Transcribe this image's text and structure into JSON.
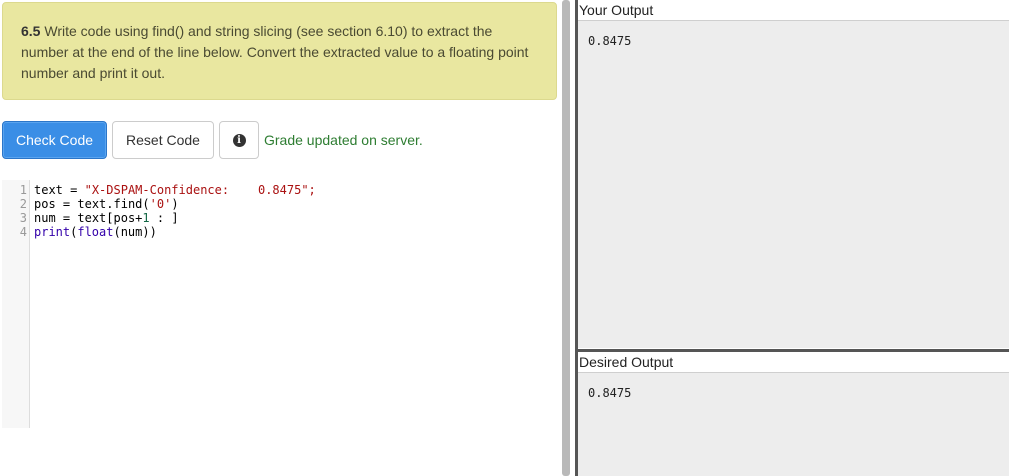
{
  "prompt": {
    "number": "6.5",
    "text": " Write code using find() and string slicing (see section 6.10) to extract the number at the end of the line below. Convert the extracted value to a floating point number and print it out."
  },
  "buttons": {
    "check_label": "Check Code",
    "reset_label": "Reset Code",
    "info_icon": "i"
  },
  "status": {
    "message": "Grade updated on server."
  },
  "editor": {
    "lines": [
      {
        "num": "1",
        "tokens": [
          {
            "t": "text",
            "c": "var"
          },
          {
            "t": " = ",
            "c": "var"
          },
          {
            "t": "\"X-DSPAM-Confidence:    0.8475\";",
            "c": "str"
          }
        ]
      },
      {
        "num": "2",
        "tokens": [
          {
            "t": "pos",
            "c": "var"
          },
          {
            "t": " = ",
            "c": "var"
          },
          {
            "t": "text.find(",
            "c": "var"
          },
          {
            "t": "'0'",
            "c": "str"
          },
          {
            "t": ")",
            "c": "var"
          }
        ]
      },
      {
        "num": "3",
        "tokens": [
          {
            "t": "num",
            "c": "var"
          },
          {
            "t": " = ",
            "c": "var"
          },
          {
            "t": "text[pos+",
            "c": "var"
          },
          {
            "t": "1",
            "c": "num"
          },
          {
            "t": " : ]",
            "c": "var"
          }
        ]
      },
      {
        "num": "4",
        "tokens": [
          {
            "t": "print",
            "c": "builtin"
          },
          {
            "t": "(",
            "c": "var"
          },
          {
            "t": "float",
            "c": "builtin"
          },
          {
            "t": "(num))",
            "c": "var"
          }
        ]
      }
    ]
  },
  "your_output": {
    "title": "Your Output",
    "value": "0.8475"
  },
  "desired_output": {
    "title": "Desired Output",
    "value": "0.8475"
  },
  "colors": {
    "prompt_bg": "#e9e7a0",
    "check_button": "#3a8ee6",
    "status_text": "#2e7d32",
    "string_token": "#aa1111",
    "number_token": "#116644",
    "builtin_token": "#3300aa"
  }
}
